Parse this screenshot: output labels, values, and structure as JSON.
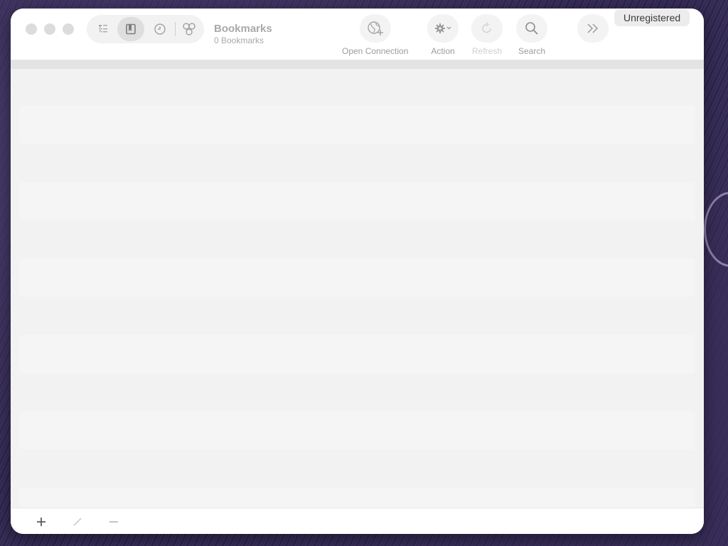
{
  "window": {
    "title": "Bookmarks",
    "subtitle": "0 Bookmarks"
  },
  "view_switcher": {
    "items": [
      {
        "name": "outline",
        "icon": "outline-list-icon",
        "selected": false
      },
      {
        "name": "bookmarks",
        "icon": "bookmark-icon",
        "selected": true
      },
      {
        "name": "history",
        "icon": "clock-icon",
        "selected": false
      },
      {
        "name": "bonjour",
        "icon": "bonjour-icon",
        "selected": false
      }
    ]
  },
  "toolbar": {
    "open_connection_label": "Open Connection",
    "action_label": "Action",
    "refresh_label": "Refresh",
    "search_label": "Search",
    "refresh_enabled": false
  },
  "registration": {
    "badge_label": "Unregistered"
  },
  "bookmark_list": {
    "count": 0,
    "items": []
  },
  "bottom_bar": {
    "add_symbol": "+",
    "remove_symbol": "−"
  },
  "colors": {
    "window_bg": "#ffffff",
    "list_bg": "#f2f2f2",
    "disabled_text": "#cfcfcf",
    "label_text": "#9c9c9c"
  }
}
